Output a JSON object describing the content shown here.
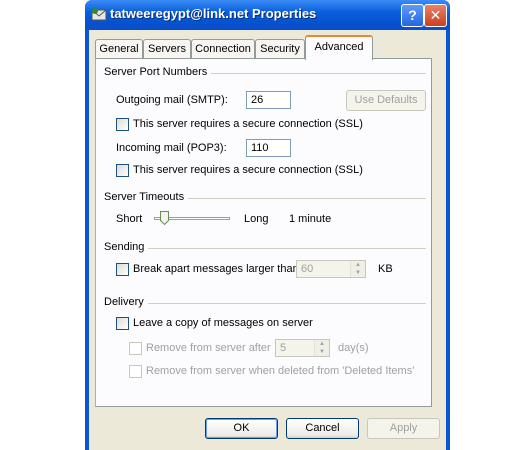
{
  "window": {
    "title": "tatweeregypt@link.net Properties",
    "help_label": "?",
    "close_label": "✕"
  },
  "tabs": [
    {
      "label": "General"
    },
    {
      "label": "Servers"
    },
    {
      "label": "Connection"
    },
    {
      "label": "Security"
    },
    {
      "label": "Advanced",
      "active": true
    }
  ],
  "ports": {
    "group_title": "Server Port Numbers",
    "smtp_label": "Outgoing mail (SMTP):",
    "smtp_value": "26",
    "use_defaults_label": "Use Defaults",
    "smtp_ssl_label": "This server requires a secure connection (SSL)",
    "pop3_label": "Incoming mail (POP3):",
    "pop3_value": "110",
    "pop3_ssl_label": "This server requires a secure connection (SSL)"
  },
  "timeouts": {
    "group_title": "Server Timeouts",
    "short_label": "Short",
    "long_label": "Long",
    "value_label": "1 minute"
  },
  "sending": {
    "group_title": "Sending",
    "break_label": "Break apart messages larger than",
    "break_value": "60",
    "unit_label": "KB"
  },
  "delivery": {
    "group_title": "Delivery",
    "leave_copy_label": "Leave a copy of messages on server",
    "remove_after_label": "Remove from server after",
    "remove_after_value": "5",
    "days_label": "day(s)",
    "remove_deleted_label": "Remove from server when deleted from 'Deleted Items'"
  },
  "footer": {
    "ok_label": "OK",
    "cancel_label": "Cancel",
    "apply_label": "Apply"
  }
}
